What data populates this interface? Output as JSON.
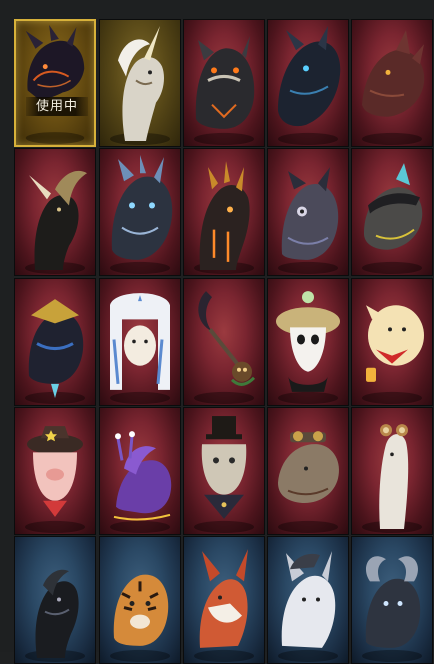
{
  "status_badge": "使用中",
  "colors": {
    "page_background": "#1e2021",
    "red_card": "#7a2530",
    "blue_card": "#2a4864",
    "selected_border": "#d7b13a"
  },
  "mounts": [
    {
      "id": "mount-black-dragon-equipped",
      "theme": "gold",
      "icon": "black-dragon-icon",
      "equipped": true
    },
    {
      "id": "mount-white-unicorn",
      "theme": "gold",
      "icon": "white-unicorn-icon",
      "equipped": false
    },
    {
      "id": "mount-armored-black-boar",
      "theme": "red",
      "icon": "armored-boar-icon",
      "equipped": false
    },
    {
      "id": "mount-dark-blue-drake",
      "theme": "red",
      "icon": "dark-drake-icon",
      "equipped": false
    },
    {
      "id": "mount-red-drake",
      "theme": "red",
      "icon": "red-drake-icon",
      "equipped": false
    },
    {
      "id": "mount-black-unicorn",
      "theme": "red",
      "icon": "black-unicorn-icon",
      "equipped": false
    },
    {
      "id": "mount-silver-blue-dragon",
      "theme": "red",
      "icon": "silver-dragon-icon",
      "equipped": false
    },
    {
      "id": "mount-fire-armored-beast",
      "theme": "red",
      "icon": "fire-beast-icon",
      "equipped": false
    },
    {
      "id": "mount-armored-owl",
      "theme": "red",
      "icon": "armored-owl-icon",
      "equipped": false
    },
    {
      "id": "mount-armored-raptor",
      "theme": "red",
      "icon": "armored-raptor-icon",
      "equipped": false
    },
    {
      "id": "mount-samurai-black-beast",
      "theme": "red",
      "icon": "samurai-beast-icon",
      "equipped": false
    },
    {
      "id": "mount-white-furry-ushanka",
      "theme": "red",
      "icon": "white-furry-hat-icon",
      "equipped": false
    },
    {
      "id": "mount-crescent-staff",
      "theme": "red",
      "icon": "crescent-staff-icon",
      "equipped": false
    },
    {
      "id": "mount-panda-straw-hat",
      "theme": "red",
      "icon": "panda-straw-hat-icon",
      "equipped": false
    },
    {
      "id": "mount-yellow-chick-lantern",
      "theme": "red",
      "icon": "chick-lantern-icon",
      "equipped": false
    },
    {
      "id": "mount-pig-sheriff-hat",
      "theme": "red",
      "icon": "pig-sheriff-icon",
      "equipped": false
    },
    {
      "id": "mount-purple-snail",
      "theme": "red",
      "icon": "purple-snail-icon",
      "equipped": false
    },
    {
      "id": "mount-gentleman-cat",
      "theme": "red",
      "icon": "gentleman-cat-icon",
      "equipped": false
    },
    {
      "id": "mount-steampunk-hedgehog",
      "theme": "red",
      "icon": "steampunk-hedgehog-icon",
      "equipped": false
    },
    {
      "id": "mount-alpaca-goggles",
      "theme": "red",
      "icon": "alpaca-goggles-icon",
      "equipped": false
    },
    {
      "id": "mount-black-horse",
      "theme": "blue",
      "icon": "black-horse-icon",
      "equipped": false
    },
    {
      "id": "mount-tiger",
      "theme": "blue",
      "icon": "tiger-icon",
      "equipped": false
    },
    {
      "id": "mount-red-fox",
      "theme": "blue",
      "icon": "red-fox-icon",
      "equipped": false
    },
    {
      "id": "mount-white-wolf",
      "theme": "blue",
      "icon": "white-wolf-icon",
      "equipped": false
    },
    {
      "id": "mount-dark-ram",
      "theme": "blue",
      "icon": "dark-ram-icon",
      "equipped": false
    }
  ]
}
